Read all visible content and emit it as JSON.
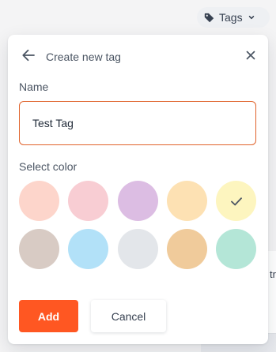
{
  "toolbar": {
    "tags_label": "Tags",
    "tags_icon": "tag-icon",
    "chevron_icon": "chevron-down-icon"
  },
  "background": {
    "peek_text": "tr"
  },
  "dialog": {
    "title": "Create new tag",
    "back_icon": "arrow-left-icon",
    "close_icon": "close-icon",
    "name_label": "Name",
    "name_value": "Test Tag",
    "color_label": "Select color",
    "selected_color_index": 4,
    "colors": [
      "#fdd5cb",
      "#f8cdd3",
      "#dcbde3",
      "#fde1b3",
      "#fdf5bf",
      "#d8cbc4",
      "#b2e1f8",
      "#e3e6ea",
      "#f0cb9b",
      "#b4e6d7"
    ],
    "add_label": "Add",
    "cancel_label": "Cancel",
    "accent_color": "#ff5722",
    "input_border_color": "#e0622b"
  }
}
